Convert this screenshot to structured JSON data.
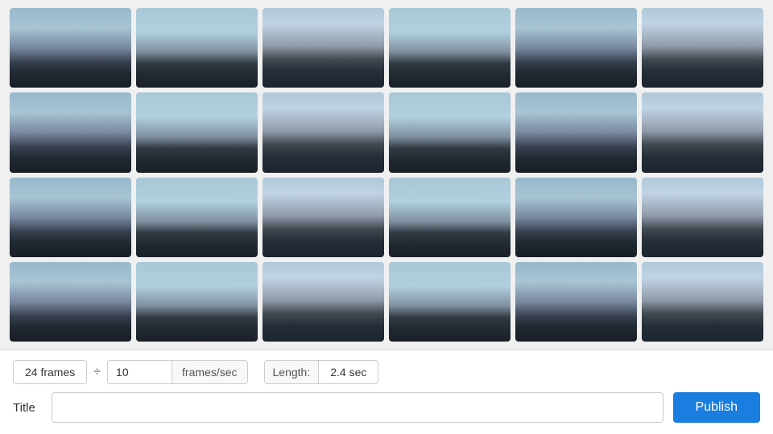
{
  "grid": {
    "total_frames": 24,
    "rows": 4,
    "cols": 6
  },
  "controls": {
    "frames_count_label": "24 frames",
    "divider_symbol": "÷",
    "fps_value": "10",
    "fps_unit_label": "frames/sec",
    "length_label": "Length:",
    "length_value": "2.4 sec",
    "title_label": "Title",
    "title_placeholder": "",
    "publish_label": "Publish"
  }
}
